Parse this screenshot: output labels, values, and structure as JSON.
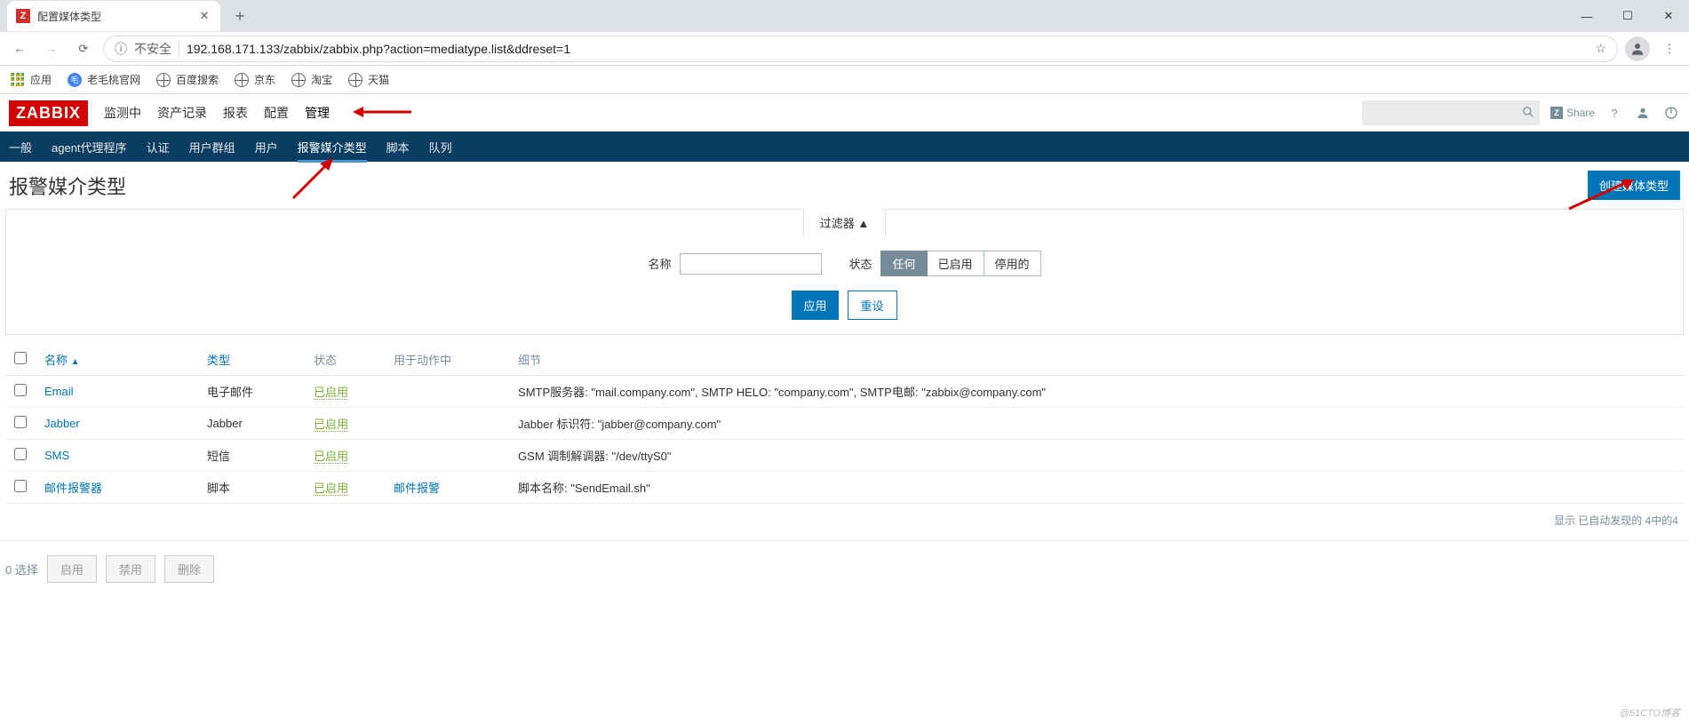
{
  "browser": {
    "tab_title": "配置媒体类型",
    "address_insecure": "不安全",
    "url_display": "192.168.171.133/zabbix/zabbix.php?action=mediatype.list&ddreset=1",
    "bookmarks": {
      "apps": "应用",
      "items": [
        "老毛桃官网",
        "百度搜索",
        "京东",
        "淘宝",
        "天猫"
      ]
    }
  },
  "zabbix": {
    "logo": "ZABBIX",
    "main_menu": [
      "监测中",
      "资产记录",
      "报表",
      "配置",
      "管理"
    ],
    "main_active": "管理",
    "share": "Share",
    "sub_menu": [
      "一般",
      "agent代理程序",
      "认证",
      "用户群组",
      "用户",
      "报警媒介类型",
      "脚本",
      "队列"
    ],
    "sub_active": "报警媒介类型"
  },
  "page": {
    "title": "报警媒介类型",
    "create_button": "创建媒体类型",
    "filter": {
      "tab": "过滤器 ▲",
      "name_label": "名称",
      "status_label": "状态",
      "status_options": [
        "任何",
        "已启用",
        "停用的"
      ],
      "apply": "应用",
      "reset": "重设"
    },
    "table": {
      "headers": {
        "name": "名称",
        "type": "类型",
        "status": "状态",
        "used_in": "用于动作中",
        "details": "细节"
      },
      "rows": [
        {
          "name": "Email",
          "type": "电子邮件",
          "status": "已启用",
          "used_in": "",
          "details": "SMTP服务器: \"mail.company.com\", SMTP HELO: \"company.com\", SMTP电邮: \"zabbix@company.com\""
        },
        {
          "name": "Jabber",
          "type": "Jabber",
          "status": "已启用",
          "used_in": "",
          "details": "Jabber 标识符: \"jabber@company.com\""
        },
        {
          "name": "SMS",
          "type": "短信",
          "status": "已启用",
          "used_in": "",
          "details": "GSM 调制解调器: \"/dev/ttyS0\""
        },
        {
          "name": "邮件报警器",
          "type": "脚本",
          "status": "已启用",
          "used_in": "邮件报警",
          "details": "脚本名称: \"SendEmail.sh\""
        }
      ],
      "footer": "显示 已自动发现的 4中的4"
    },
    "bottom": {
      "selected": "0 选择",
      "enable": "启用",
      "disable": "禁用",
      "delete": "删除"
    }
  },
  "watermark": "@51CTO博客"
}
